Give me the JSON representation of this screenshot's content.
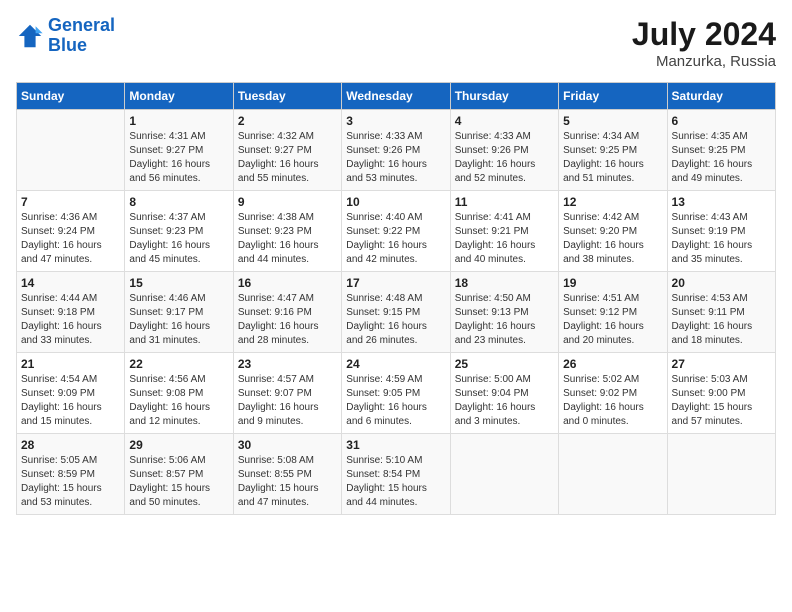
{
  "header": {
    "logo_line1": "General",
    "logo_line2": "Blue",
    "month_year": "July 2024",
    "location": "Manzurka, Russia"
  },
  "weekdays": [
    "Sunday",
    "Monday",
    "Tuesday",
    "Wednesday",
    "Thursday",
    "Friday",
    "Saturday"
  ],
  "weeks": [
    [
      {
        "day": "",
        "sunrise": "",
        "sunset": "",
        "daylight": ""
      },
      {
        "day": "1",
        "sunrise": "Sunrise: 4:31 AM",
        "sunset": "Sunset: 9:27 PM",
        "daylight": "Daylight: 16 hours and 56 minutes."
      },
      {
        "day": "2",
        "sunrise": "Sunrise: 4:32 AM",
        "sunset": "Sunset: 9:27 PM",
        "daylight": "Daylight: 16 hours and 55 minutes."
      },
      {
        "day": "3",
        "sunrise": "Sunrise: 4:33 AM",
        "sunset": "Sunset: 9:26 PM",
        "daylight": "Daylight: 16 hours and 53 minutes."
      },
      {
        "day": "4",
        "sunrise": "Sunrise: 4:33 AM",
        "sunset": "Sunset: 9:26 PM",
        "daylight": "Daylight: 16 hours and 52 minutes."
      },
      {
        "day": "5",
        "sunrise": "Sunrise: 4:34 AM",
        "sunset": "Sunset: 9:25 PM",
        "daylight": "Daylight: 16 hours and 51 minutes."
      },
      {
        "day": "6",
        "sunrise": "Sunrise: 4:35 AM",
        "sunset": "Sunset: 9:25 PM",
        "daylight": "Daylight: 16 hours and 49 minutes."
      }
    ],
    [
      {
        "day": "7",
        "sunrise": "Sunrise: 4:36 AM",
        "sunset": "Sunset: 9:24 PM",
        "daylight": "Daylight: 16 hours and 47 minutes."
      },
      {
        "day": "8",
        "sunrise": "Sunrise: 4:37 AM",
        "sunset": "Sunset: 9:23 PM",
        "daylight": "Daylight: 16 hours and 45 minutes."
      },
      {
        "day": "9",
        "sunrise": "Sunrise: 4:38 AM",
        "sunset": "Sunset: 9:23 PM",
        "daylight": "Daylight: 16 hours and 44 minutes."
      },
      {
        "day": "10",
        "sunrise": "Sunrise: 4:40 AM",
        "sunset": "Sunset: 9:22 PM",
        "daylight": "Daylight: 16 hours and 42 minutes."
      },
      {
        "day": "11",
        "sunrise": "Sunrise: 4:41 AM",
        "sunset": "Sunset: 9:21 PM",
        "daylight": "Daylight: 16 hours and 40 minutes."
      },
      {
        "day": "12",
        "sunrise": "Sunrise: 4:42 AM",
        "sunset": "Sunset: 9:20 PM",
        "daylight": "Daylight: 16 hours and 38 minutes."
      },
      {
        "day": "13",
        "sunrise": "Sunrise: 4:43 AM",
        "sunset": "Sunset: 9:19 PM",
        "daylight": "Daylight: 16 hours and 35 minutes."
      }
    ],
    [
      {
        "day": "14",
        "sunrise": "Sunrise: 4:44 AM",
        "sunset": "Sunset: 9:18 PM",
        "daylight": "Daylight: 16 hours and 33 minutes."
      },
      {
        "day": "15",
        "sunrise": "Sunrise: 4:46 AM",
        "sunset": "Sunset: 9:17 PM",
        "daylight": "Daylight: 16 hours and 31 minutes."
      },
      {
        "day": "16",
        "sunrise": "Sunrise: 4:47 AM",
        "sunset": "Sunset: 9:16 PM",
        "daylight": "Daylight: 16 hours and 28 minutes."
      },
      {
        "day": "17",
        "sunrise": "Sunrise: 4:48 AM",
        "sunset": "Sunset: 9:15 PM",
        "daylight": "Daylight: 16 hours and 26 minutes."
      },
      {
        "day": "18",
        "sunrise": "Sunrise: 4:50 AM",
        "sunset": "Sunset: 9:13 PM",
        "daylight": "Daylight: 16 hours and 23 minutes."
      },
      {
        "day": "19",
        "sunrise": "Sunrise: 4:51 AM",
        "sunset": "Sunset: 9:12 PM",
        "daylight": "Daylight: 16 hours and 20 minutes."
      },
      {
        "day": "20",
        "sunrise": "Sunrise: 4:53 AM",
        "sunset": "Sunset: 9:11 PM",
        "daylight": "Daylight: 16 hours and 18 minutes."
      }
    ],
    [
      {
        "day": "21",
        "sunrise": "Sunrise: 4:54 AM",
        "sunset": "Sunset: 9:09 PM",
        "daylight": "Daylight: 16 hours and 15 minutes."
      },
      {
        "day": "22",
        "sunrise": "Sunrise: 4:56 AM",
        "sunset": "Sunset: 9:08 PM",
        "daylight": "Daylight: 16 hours and 12 minutes."
      },
      {
        "day": "23",
        "sunrise": "Sunrise: 4:57 AM",
        "sunset": "Sunset: 9:07 PM",
        "daylight": "Daylight: 16 hours and 9 minutes."
      },
      {
        "day": "24",
        "sunrise": "Sunrise: 4:59 AM",
        "sunset": "Sunset: 9:05 PM",
        "daylight": "Daylight: 16 hours and 6 minutes."
      },
      {
        "day": "25",
        "sunrise": "Sunrise: 5:00 AM",
        "sunset": "Sunset: 9:04 PM",
        "daylight": "Daylight: 16 hours and 3 minutes."
      },
      {
        "day": "26",
        "sunrise": "Sunrise: 5:02 AM",
        "sunset": "Sunset: 9:02 PM",
        "daylight": "Daylight: 16 hours and 0 minutes."
      },
      {
        "day": "27",
        "sunrise": "Sunrise: 5:03 AM",
        "sunset": "Sunset: 9:00 PM",
        "daylight": "Daylight: 15 hours and 57 minutes."
      }
    ],
    [
      {
        "day": "28",
        "sunrise": "Sunrise: 5:05 AM",
        "sunset": "Sunset: 8:59 PM",
        "daylight": "Daylight: 15 hours and 53 minutes."
      },
      {
        "day": "29",
        "sunrise": "Sunrise: 5:06 AM",
        "sunset": "Sunset: 8:57 PM",
        "daylight": "Daylight: 15 hours and 50 minutes."
      },
      {
        "day": "30",
        "sunrise": "Sunrise: 5:08 AM",
        "sunset": "Sunset: 8:55 PM",
        "daylight": "Daylight: 15 hours and 47 minutes."
      },
      {
        "day": "31",
        "sunrise": "Sunrise: 5:10 AM",
        "sunset": "Sunset: 8:54 PM",
        "daylight": "Daylight: 15 hours and 44 minutes."
      },
      {
        "day": "",
        "sunrise": "",
        "sunset": "",
        "daylight": ""
      },
      {
        "day": "",
        "sunrise": "",
        "sunset": "",
        "daylight": ""
      },
      {
        "day": "",
        "sunrise": "",
        "sunset": "",
        "daylight": ""
      }
    ]
  ]
}
